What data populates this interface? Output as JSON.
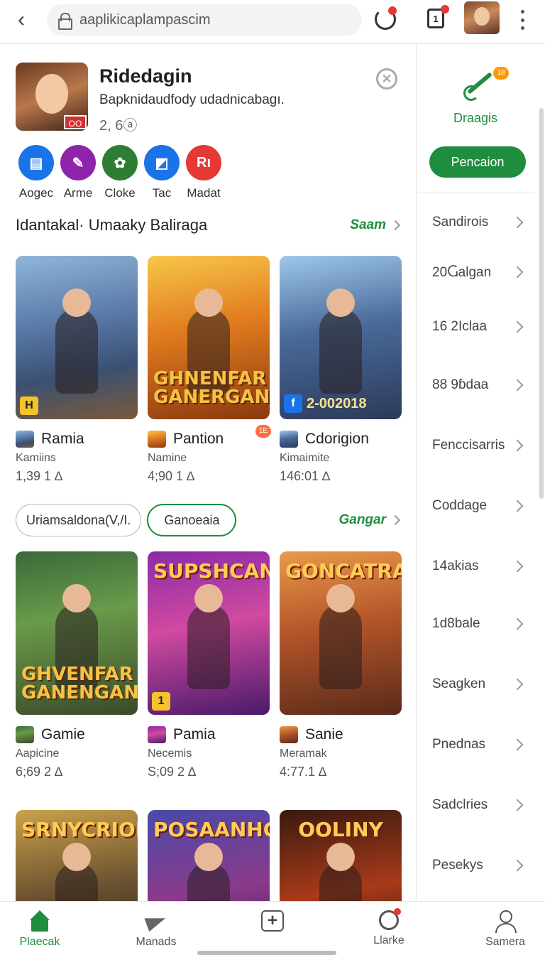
{
  "browser": {
    "url": "aaplikicaplampascim",
    "tab_count": "1"
  },
  "app": {
    "title": "Ridedagin",
    "subtitle": "Bapknidaudfody udadnicabagı.",
    "rating": "2, 6ⓐ",
    "icon_badge": "OO"
  },
  "categories": [
    {
      "label": "Aogec",
      "color": "#1a73e8",
      "glyph": "▤"
    },
    {
      "label": "Arme",
      "color": "#8e24aa",
      "glyph": "✎"
    },
    {
      "label": "Cloke",
      "color": "#2e7d32",
      "glyph": "✿"
    },
    {
      "label": "Tac",
      "color": "#1a73e8",
      "glyph": "◩"
    },
    {
      "label": "Madat",
      "color": "#e53935",
      "glyph": "Rı"
    }
  ],
  "section1": {
    "title": "Idantakal· Umaaky Baliraga",
    "more": "Saam"
  },
  "row1": [
    {
      "name": "Ramia",
      "dev": "Kamiins",
      "meta": "1,39 1 ∆",
      "bg": "linear-gradient(170deg,#8fb6d9,#5a7aa8 40%,#3b5072 70%,#7a5a3a)",
      "corner": "H",
      "title_bottom": "",
      "title_top": "",
      "tag": ""
    },
    {
      "name": "Pantion",
      "dev": "Namine",
      "meta": "4;90 1 ∆",
      "bg": "linear-gradient(170deg,#f8c64a,#e07a1e 45%,#8a3a10)",
      "corner": "",
      "title_bottom": "GHNENFAR GANERGAN",
      "title_top": "",
      "tag": "",
      "hot": "1E"
    },
    {
      "name": "Cdorigion",
      "dev": "Kimaimite",
      "meta": "146:01 ∆",
      "bg": "linear-gradient(170deg,#9ec8ea,#4a6a9a 45%,#2c3a5a)",
      "corner": "",
      "title_bottom": "",
      "title_top": "",
      "tag": "2-002018"
    }
  ],
  "chips": {
    "chip1": "Uriamsaldona(V,/I.",
    "chip2": "Ganoeaia",
    "more": "Gangar"
  },
  "row2": [
    {
      "name": "Gamie",
      "dev": "Aapicine",
      "meta": "6;69 2 ∆",
      "bg": "linear-gradient(170deg,#3a6a3a,#6a9a4a 40%,#3a4a2a)",
      "corner": "",
      "title_bottom": "GHVENFAR GANENGAN",
      "title_top": ""
    },
    {
      "name": "Pamia",
      "dev": "Necemis",
      "meta": "S;09 2 ∆",
      "bg": "linear-gradient(170deg,#8a2aa8,#d04aa0 45%,#4a1a6a)",
      "corner": "1",
      "title_bottom": "",
      "title_top": "SUPSHCAN"
    },
    {
      "name": "Sanie",
      "dev": "Meramak",
      "meta": "4:77.1 ∆",
      "bg": "linear-gradient(170deg,#e89a4a,#b5562a 45%,#5a2a1a)",
      "corner": "",
      "title_bottom": "",
      "title_top": "GONCATRAR"
    }
  ],
  "row3": [
    {
      "bg": "linear-gradient(170deg,#c9a24a,#6a5030 50%,#2a2018)",
      "title_top": "SRNYCRIOMAN"
    },
    {
      "bg": "linear-gradient(170deg,#4a4aa8,#8a3a8a 50%,#3a1a4a)",
      "title_top": "POSAANHCAN"
    },
    {
      "bg": "linear-gradient(170deg,#3a1a10,#a83a1a 50%,#1a0a08)",
      "title_top": "OOLINY"
    }
  ],
  "side": {
    "label": "Draagis",
    "badge": "18",
    "button": "Pencaion",
    "items": [
      "Sandirois",
      "20Ⴚalgan",
      "16 2Iclaa",
      "88 9ɓdaa",
      "Fenccisarris",
      "Coddage",
      "14akias",
      "1d8bale",
      "Seagken",
      "Pnednas",
      "Sadclries",
      "Pesekys"
    ]
  },
  "nav": [
    {
      "label": "Plaecak",
      "active": true
    },
    {
      "label": "Manads",
      "active": false
    },
    {
      "label": "",
      "active": false
    },
    {
      "label": "Llarke",
      "active": false
    },
    {
      "label": "Samera",
      "active": false
    }
  ]
}
